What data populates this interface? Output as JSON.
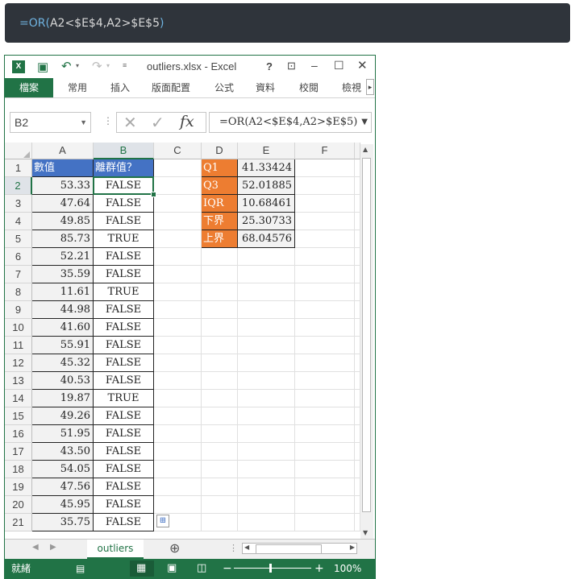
{
  "banner": {
    "formula_parts": [
      {
        "text": "=OR(",
        "cls": "c-func"
      },
      {
        "text": "A2",
        "cls": "c-plain"
      },
      {
        "text": "<",
        "cls": "c-op"
      },
      {
        "text": "$E$4",
        "cls": "c-plain"
      },
      {
        "text": ",",
        "cls": "c-plain"
      },
      {
        "text": "A2",
        "cls": "c-plain"
      },
      {
        "text": ">",
        "cls": "c-op"
      },
      {
        "text": "$E$5",
        "cls": "c-plain"
      },
      {
        "text": ")",
        "cls": "c-func"
      }
    ]
  },
  "window": {
    "title": "outliers.xlsx - Excel",
    "help_icon": "?",
    "ribbon_tabs": [
      "檔案",
      "常用",
      "插入",
      "版面配置",
      "公式",
      "資料",
      "校閱",
      "檢視"
    ]
  },
  "formula_bar": {
    "name_box": "B2",
    "formula": "=OR(A2<$E$4,A2>$E$5)"
  },
  "columns": [
    "A",
    "B",
    "C",
    "D",
    "E",
    "F"
  ],
  "rows": [
    "1",
    "2",
    "3",
    "4",
    "5",
    "6",
    "7",
    "8",
    "9",
    "10",
    "11",
    "12",
    "13",
    "14",
    "15",
    "16",
    "17",
    "18",
    "19",
    "20",
    "21"
  ],
  "table": {
    "header_a": "數值",
    "header_b": "離群值？",
    "values": [
      "53.33",
      "47.64",
      "49.85",
      "85.73",
      "52.21",
      "35.59",
      "11.61",
      "44.98",
      "41.60",
      "55.91",
      "45.32",
      "40.53",
      "19.87",
      "49.26",
      "51.95",
      "43.50",
      "54.05",
      "47.56",
      "45.95",
      "35.75"
    ],
    "flags": [
      "FALSE",
      "FALSE",
      "FALSE",
      "TRUE",
      "FALSE",
      "FALSE",
      "TRUE",
      "FALSE",
      "FALSE",
      "FALSE",
      "FALSE",
      "FALSE",
      "TRUE",
      "FALSE",
      "FALSE",
      "FALSE",
      "FALSE",
      "FALSE",
      "FALSE",
      "FALSE"
    ]
  },
  "stats": [
    {
      "label": "Q1",
      "value": "41.33424"
    },
    {
      "label": "Q3",
      "value": "52.01885"
    },
    {
      "label": "IQR",
      "value": "10.68461"
    },
    {
      "label": "下界",
      "value": "25.30733"
    },
    {
      "label": "上界",
      "value": "68.04576"
    }
  ],
  "sheet": {
    "tab": "outliers"
  },
  "status": {
    "mode": "就緒",
    "zoom": "100%"
  },
  "colors": {
    "header_blue": "#4472c4",
    "header_orange": "#ed7d31",
    "excel_green": "#217346"
  }
}
